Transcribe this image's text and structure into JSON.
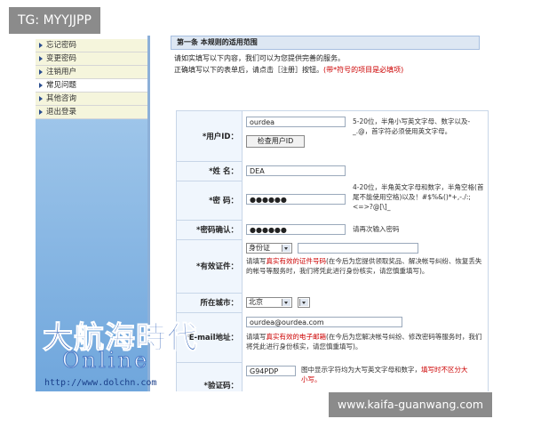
{
  "watermark_top": "TG: MYYJJPP",
  "watermark_bottom": "www.kaifa-guanwang.com",
  "sidebar": {
    "items": [
      {
        "label": "忘记密码"
      },
      {
        "label": "变更密码"
      },
      {
        "label": "注销用户"
      },
      {
        "label": "常见问题"
      },
      {
        "label": "其他咨询"
      },
      {
        "label": "退出登录"
      }
    ]
  },
  "main": {
    "section_title": "第一条  本规则的适用范围",
    "intro_line1": "请如实填写以下内容，我们可以为您提供完善的服务。",
    "intro_line2": "正确填写以下的表单后，请点击［注册］按钮。",
    "intro_required": "(带*符号的项目是必填项)"
  },
  "form": {
    "username": {
      "label": "*用户ID：",
      "value": "ourdea",
      "check_button": "检查用户ID",
      "hint": "5-20位，半角小写英文字母、数字以及-_.@，首字符必须使用英文字母。"
    },
    "name": {
      "label": "*姓  名：",
      "value": "DEA"
    },
    "password": {
      "label": "*密  码：",
      "value": "●●●●●●",
      "hint": "4-20位，半角英文字母和数字，半角空格(首尾不能使用空格)以及！#$%&()*+,-./:;<=>?@[\\]_"
    },
    "password_confirm": {
      "label": "*密码确认：",
      "value": "●●●●●●",
      "hint": "请再次输入密码"
    },
    "id_doc": {
      "label": "*有效证件：",
      "type_selected": "身份证",
      "value": "",
      "hint_prefix": "请填写",
      "hint_red": "真实有效的证件号码",
      "hint_rest": "(在今后为您提供领取奖品、解决帐号纠纷、恢复丢失的帐号等服务时，我们将凭此进行身份核实，请您慎重填写)。"
    },
    "city": {
      "label": "所在城市：",
      "selected": "北京",
      "second": ""
    },
    "email": {
      "label": "*E-mail地址：",
      "value": "ourdea@ourdea.com",
      "hint_prefix": "请填写",
      "hint_red": "真实有效的电子邮箱",
      "hint_rest": "(在今后为您解决帐号纠纷、修改密码等服务时，我们将凭此进行身份核实，请您慎重填写)。"
    },
    "captcha": {
      "label": "*验证码：",
      "code": "G94PDP",
      "hint": "图中显示字符均为大写英文字母和数字，",
      "hint_red": "填写时不区分大小写。"
    }
  },
  "logo": {
    "line1": "大航海時代",
    "line2": "Online",
    "url": "http://www.dolchn.com"
  },
  "colors": {
    "accent_blue": "#2f60b8",
    "required_red": "#cc0000",
    "form_bg": "#f0f6fd"
  }
}
